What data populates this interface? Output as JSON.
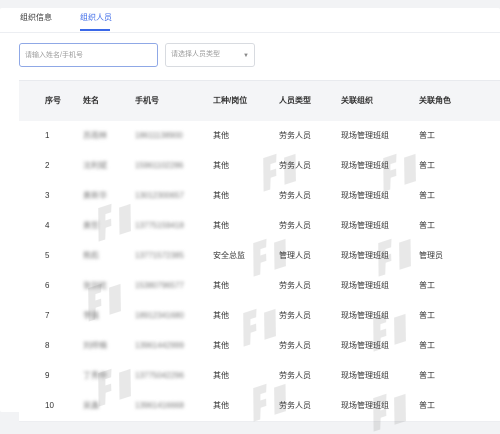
{
  "tabs": [
    {
      "label": "组织信息",
      "active": false
    },
    {
      "label": "组织人员",
      "active": true
    }
  ],
  "colors": {
    "accent": "#3a68e8"
  },
  "filters": {
    "search_placeholder": "请输入姓名/手机号",
    "type_placeholder": "请选择人员类型"
  },
  "table": {
    "headers": {
      "idx": "序号",
      "name": "姓名",
      "phone": "手机号",
      "job": "工种/岗位",
      "type": "人员类型",
      "org": "关联组织",
      "role": "关联角色"
    },
    "rows": [
      {
        "idx": "1",
        "name": "苏雨林",
        "phone": "18611138900",
        "job": "其他",
        "type": "劳务人员",
        "org": "现场管理班组",
        "role": "普工"
      },
      {
        "idx": "2",
        "name": "沈利斌",
        "phone": "15961102286",
        "job": "其他",
        "type": "劳务人员",
        "org": "现场管理班组",
        "role": "普工"
      },
      {
        "idx": "3",
        "name": "黄新华",
        "phone": "13012300657",
        "job": "其他",
        "type": "劳务人员",
        "org": "现场管理班组",
        "role": "普工"
      },
      {
        "idx": "4",
        "name": "黄哲",
        "phone": "13775159418",
        "job": "其他",
        "type": "劳务人员",
        "org": "现场管理班组",
        "role": "普工"
      },
      {
        "idx": "5",
        "name": "熊彪",
        "phone": "13771572385",
        "job": "安全总监",
        "type": "管理人员",
        "org": "现场管理班组",
        "role": "管理员"
      },
      {
        "idx": "6",
        "name": "张剑屹",
        "phone": "15380796577",
        "job": "其他",
        "type": "劳务人员",
        "org": "现场管理班组",
        "role": "普工"
      },
      {
        "idx": "7",
        "name": "李强",
        "phone": "18912341680",
        "job": "其他",
        "type": "劳务人员",
        "org": "现场管理班组",
        "role": "普工"
      },
      {
        "idx": "8",
        "name": "刘梓楠",
        "phone": "13961442999",
        "job": "其他",
        "type": "劳务人员",
        "org": "现场管理班组",
        "role": "普工"
      },
      {
        "idx": "9",
        "name": "丁秀中",
        "phone": "13775042296",
        "job": "其他",
        "type": "劳务人员",
        "org": "现场管理班组",
        "role": "普工"
      },
      {
        "idx": "10",
        "name": "吴鑫",
        "phone": "13961416668",
        "job": "其他",
        "type": "劳务人员",
        "org": "现场管理班组",
        "role": "普工"
      }
    ]
  }
}
